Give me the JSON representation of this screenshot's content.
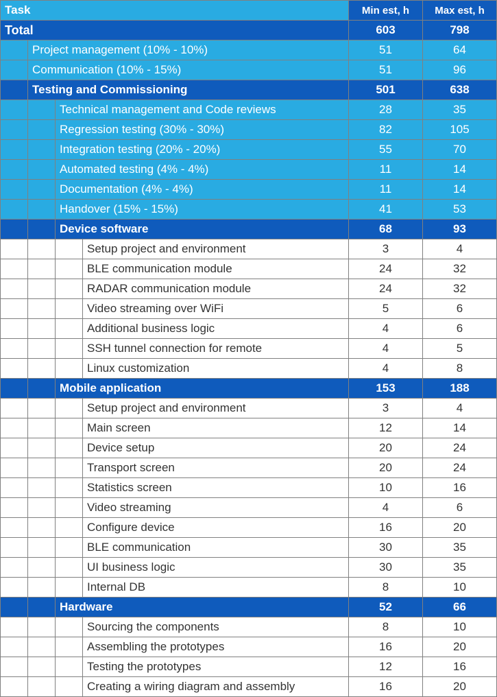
{
  "header": {
    "task": "Task",
    "min": "Min est, h",
    "max": "Max est, h"
  },
  "total": {
    "label": "Total",
    "min": "603",
    "max": "798"
  },
  "lvl1": [
    {
      "label": "Project management (10% - 10%)",
      "min": "51",
      "max": "64"
    },
    {
      "label": "Communication (10% - 15%)",
      "min": "51",
      "max": "96"
    }
  ],
  "testing": {
    "label": "Testing and Commissioning",
    "min": "501",
    "max": "638",
    "items": [
      {
        "label": "Technical management and Code reviews",
        "min": "28",
        "max": "35"
      },
      {
        "label": "Regression testing (30% - 30%)",
        "min": "82",
        "max": "105"
      },
      {
        "label": "Integration testing (20% - 20%)",
        "min": "55",
        "max": "70"
      },
      {
        "label": "Automated testing (4% - 4%)",
        "min": "11",
        "max": "14"
      },
      {
        "label": "Documentation (4% - 4%)",
        "min": "11",
        "max": "14"
      },
      {
        "label": "Handover (15% - 15%)",
        "min": "41",
        "max": "53"
      }
    ]
  },
  "device": {
    "label": "Device software",
    "min": "68",
    "max": "93",
    "items": [
      {
        "label": "Setup project and environment",
        "min": "3",
        "max": "4"
      },
      {
        "label": "BLE communication module",
        "min": "24",
        "max": "32"
      },
      {
        "label": "RADAR communication module",
        "min": "24",
        "max": "32"
      },
      {
        "label": "Video streaming over WiFi",
        "min": "5",
        "max": "6"
      },
      {
        "label": "Additional business logic",
        "min": "4",
        "max": "6"
      },
      {
        "label": "SSH tunnel connection for remote",
        "min": "4",
        "max": "5"
      },
      {
        "label": "Linux customization",
        "min": "4",
        "max": "8"
      }
    ]
  },
  "mobile": {
    "label": "Mobile application",
    "min": "153",
    "max": "188",
    "items": [
      {
        "label": "Setup project and environment",
        "min": "3",
        "max": "4"
      },
      {
        "label": "Main screen",
        "min": "12",
        "max": "14"
      },
      {
        "label": "Device setup",
        "min": "20",
        "max": "24"
      },
      {
        "label": "Transport screen",
        "min": "20",
        "max": "24"
      },
      {
        "label": "Statistics screen",
        "min": "10",
        "max": "16"
      },
      {
        "label": "Video streaming",
        "min": "4",
        "max": "6"
      },
      {
        "label": "Configure device",
        "min": "16",
        "max": "20"
      },
      {
        "label": "BLE communication",
        "min": "30",
        "max": "35"
      },
      {
        "label": "UI business logic",
        "min": "30",
        "max": "35"
      },
      {
        "label": "Internal DB",
        "min": "8",
        "max": "10"
      }
    ]
  },
  "hardware": {
    "label": "Hardware",
    "min": "52",
    "max": "66",
    "items": [
      {
        "label": "Sourcing the components",
        "min": "8",
        "max": "10"
      },
      {
        "label": "Assembling the prototypes",
        "min": "16",
        "max": "20"
      },
      {
        "label": "Testing the prototypes",
        "min": "12",
        "max": "16"
      },
      {
        "label": "Creating a wiring diagram and assembly",
        "min": "16",
        "max": "20"
      }
    ]
  }
}
